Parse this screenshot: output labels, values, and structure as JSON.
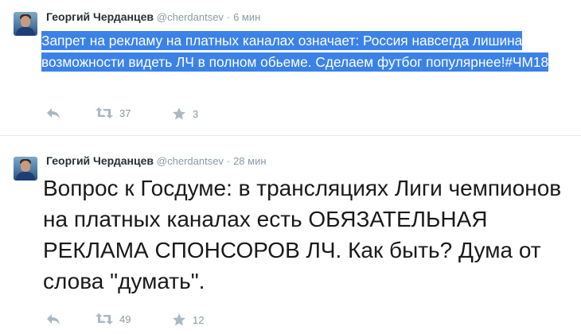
{
  "tweets": [
    {
      "author_name": "Георгий Черданцев",
      "handle": "@cherdantsev",
      "separator": "·",
      "time": "6 мин",
      "text": "Запрет на рекламу на платных каналах означает: Россия навсегда лишина возможности видеть ЛЧ в полном обьеме. Сделаем футбог популярнее!#ЧМ18",
      "text_selected": true,
      "retweets": "37",
      "favorites": "3"
    },
    {
      "author_name": "Георгий Черданцев",
      "handle": "@cherdantsev",
      "separator": "·",
      "time": "28 мин",
      "text": "Вопрос к Госдуме: в трансляциях Лиги чемпионов на платных каналах есть ОБЯЗАТЕЛЬНАЯ РЕКЛАМА СПОНСОРОВ ЛЧ. Как быть? Дума от слова \"думать\".",
      "text_selected": false,
      "retweets": "49",
      "favorites": "12"
    }
  ],
  "icons": {
    "reply": "reply-icon",
    "retweet": "retweet-icon",
    "favorite": "star-icon"
  },
  "colors": {
    "selection": "#3b82e8",
    "action_gray": "#aab8c2",
    "meta_gray": "#8899a6",
    "name": "#292f33"
  }
}
